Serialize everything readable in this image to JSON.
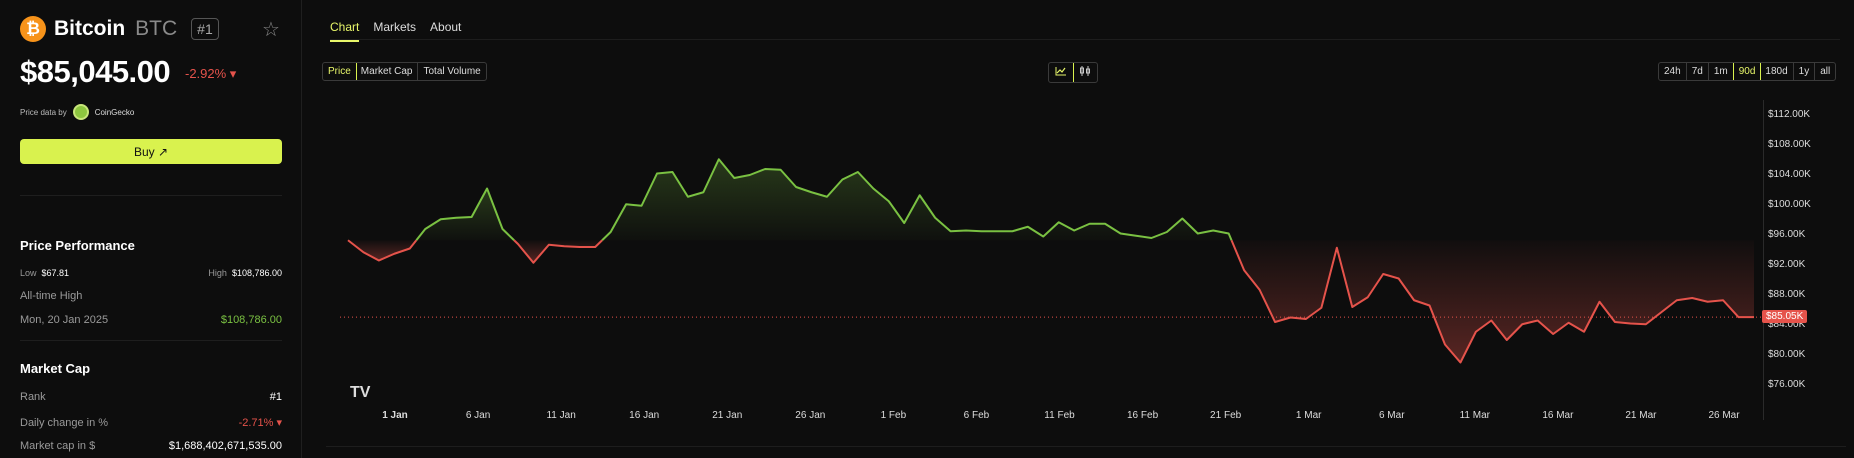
{
  "coin": {
    "name": "Bitcoin",
    "symbol": "BTC",
    "rank": "#1",
    "logo_glyph": "₿",
    "price": "$85,045.00",
    "change": "-2.92% ▾",
    "price_data_by": "Price data by",
    "source": "CoinGecko",
    "buy_label": "Buy ↗"
  },
  "performance": {
    "title": "Price Performance",
    "low_label": "Low",
    "low_value": "$67.81",
    "high_label": "High",
    "high_value": "$108,786.00",
    "ath_label": "All-time High",
    "ath_date": "Mon, 20 Jan 2025",
    "ath_value": "$108,786.00"
  },
  "market_cap": {
    "title": "Market Cap",
    "rank_label": "Rank",
    "rank_value": "#1",
    "daily_label": "Daily change in %",
    "daily_value": "-2.71% ▾",
    "cap_label": "Market cap in $",
    "cap_value": "$1,688,402,671,535.00"
  },
  "tabs": [
    "Chart",
    "Markets",
    "About"
  ],
  "metric_buttons": [
    "Price",
    "Market Cap",
    "Total Volume"
  ],
  "range_buttons": [
    "24h",
    "7d",
    "1m",
    "90d",
    "180d",
    "1y",
    "all"
  ],
  "selected_range": "90d",
  "colors": {
    "accent": "#d9f24e",
    "up": "#7ac142",
    "down": "#e5534b"
  },
  "chart_data": {
    "type": "line",
    "baseline": 95300,
    "last_label": "$85.05K",
    "y_ticks": [
      "$112.00K",
      "$108.00K",
      "$104.00K",
      "$100.00K",
      "$96.00K",
      "$92.00K",
      "$88.00K",
      "$84.00K",
      "$80.00K",
      "$76.00K"
    ],
    "ylim": [
      74000,
      114000
    ],
    "x_ticks": [
      "1 Jan",
      "6 Jan",
      "11 Jan",
      "16 Jan",
      "21 Jan",
      "26 Jan",
      "1 Feb",
      "6 Feb",
      "11 Feb",
      "16 Feb",
      "21 Feb",
      "1 Mar",
      "6 Mar",
      "11 Mar",
      "16 Mar",
      "21 Mar",
      "26 Mar"
    ],
    "values": [
      95300,
      93700,
      92600,
      93500,
      94200,
      96800,
      98100,
      98300,
      98400,
      102200,
      96800,
      94800,
      92300,
      94700,
      94500,
      94400,
      94400,
      96400,
      100100,
      99900,
      104200,
      104400,
      101100,
      101700,
      106100,
      103600,
      104000,
      104800,
      104700,
      102400,
      101700,
      101100,
      103400,
      104400,
      102200,
      100500,
      97600,
      101300,
      98300,
      96500,
      96600,
      96500,
      96500,
      96500,
      97100,
      95800,
      97700,
      96600,
      97500,
      97500,
      96200,
      95900,
      95600,
      96400,
      98200,
      96200,
      96600,
      96200,
      91300,
      88700,
      84400,
      85000,
      84800,
      86300,
      94300,
      86400,
      87700,
      90800,
      90200,
      87300,
      86600,
      81400,
      79000,
      83100,
      84600,
      82000,
      84100,
      84600,
      82800,
      84300,
      83100,
      87100,
      84400,
      84200,
      84100,
      85700,
      87300,
      87600,
      87100,
      87300,
      85045,
      85045
    ]
  }
}
